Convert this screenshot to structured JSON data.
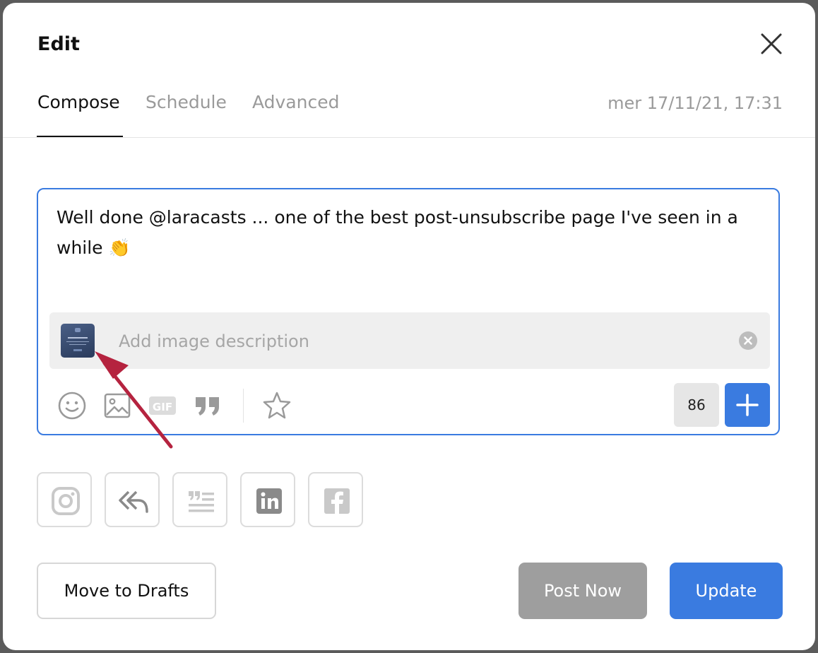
{
  "dialog": {
    "title": "Edit",
    "close_icon": "close-icon"
  },
  "tabs": [
    {
      "label": "Compose",
      "active": true
    },
    {
      "label": "Schedule",
      "active": false
    },
    {
      "label": "Advanced",
      "active": false
    }
  ],
  "timestamp": "mer 17/11/21, 17:31",
  "composer": {
    "post_text": "Well done @laracasts ... one of the best post-unsubscribe page I've seen in a while 👏",
    "image_description": {
      "value": "",
      "placeholder": "Add image description"
    },
    "toolbar_icons": [
      "emoji-icon",
      "image-icon",
      "gif-icon",
      "quote-icon",
      "star-icon"
    ],
    "char_count": "86",
    "add_icon": "plus-icon"
  },
  "social_icons": [
    "instagram-icon",
    "reply-icon",
    "quote-thread-icon",
    "linkedin-icon",
    "facebook-icon"
  ],
  "buttons": {
    "move_to_drafts": "Move to Drafts",
    "post_now": "Post Now",
    "update": "Update"
  },
  "colors": {
    "accent": "#3a7be0",
    "disabled": "#9e9e9e",
    "arrow": "#b5233f"
  }
}
